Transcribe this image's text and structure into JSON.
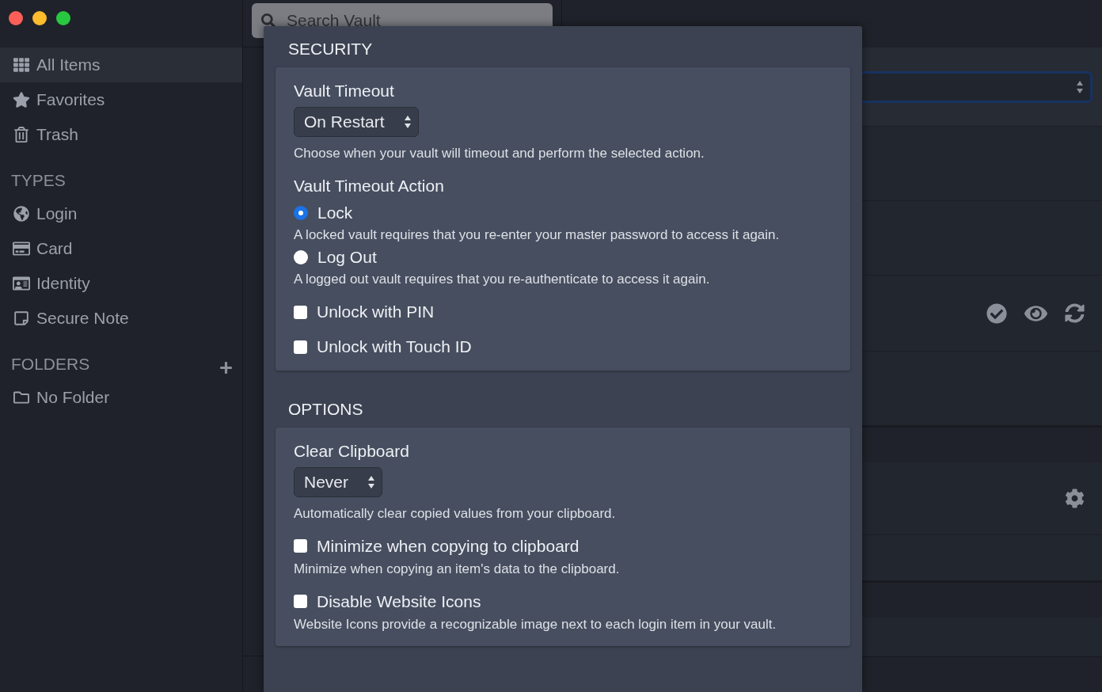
{
  "sidebar": {
    "items": [
      {
        "label": "All Items",
        "kind": "grid",
        "selected": true
      },
      {
        "label": "Favorites",
        "kind": "star",
        "selected": false
      },
      {
        "label": "Trash",
        "kind": "trash",
        "selected": false
      }
    ],
    "sections": [
      {
        "heading": "TYPES",
        "add_button": false,
        "items": [
          {
            "label": "Login",
            "kind": "globe",
            "selected": false
          },
          {
            "label": "Card",
            "kind": "card",
            "selected": false
          },
          {
            "label": "Identity",
            "kind": "id",
            "selected": false
          },
          {
            "label": "Secure Note",
            "kind": "note",
            "selected": false
          }
        ]
      },
      {
        "heading": "FOLDERS",
        "add_button": true,
        "items": [
          {
            "label": "No Folder",
            "kind": "folder",
            "selected": false
          }
        ]
      }
    ]
  },
  "search": {
    "placeholder": "Search Vault"
  },
  "settings": {
    "sections": [
      {
        "heading": "SECURITY",
        "fields": [
          {
            "kind": "select",
            "label": "Vault Timeout",
            "value": "On Restart",
            "help": "Choose when your vault will timeout and perform the selected action."
          },
          {
            "kind": "radio_group",
            "label": "Vault Timeout Action",
            "options": [
              {
                "label": "Lock",
                "selected": true,
                "help": "A locked vault requires that you re-enter your master password to access it again."
              },
              {
                "label": "Log Out",
                "selected": false,
                "help": "A logged out vault requires that you re-authenticate to access it again."
              }
            ]
          },
          {
            "kind": "checkbox",
            "label": "Unlock with PIN",
            "checked": false
          },
          {
            "kind": "checkbox",
            "label": "Unlock with Touch ID",
            "checked": false
          }
        ]
      },
      {
        "heading": "OPTIONS",
        "fields": [
          {
            "kind": "select",
            "label": "Clear Clipboard",
            "value": "Never",
            "help": "Automatically clear copied values from your clipboard."
          },
          {
            "kind": "checkbox",
            "label": "Minimize when copying to clipboard",
            "checked": false,
            "help": "Minimize when copying an item's data to the clipboard."
          },
          {
            "kind": "checkbox",
            "label": "Disable Website Icons",
            "checked": false,
            "help": "Website Icons provide a recognizable image next to each login item in your vault."
          }
        ]
      }
    ]
  }
}
